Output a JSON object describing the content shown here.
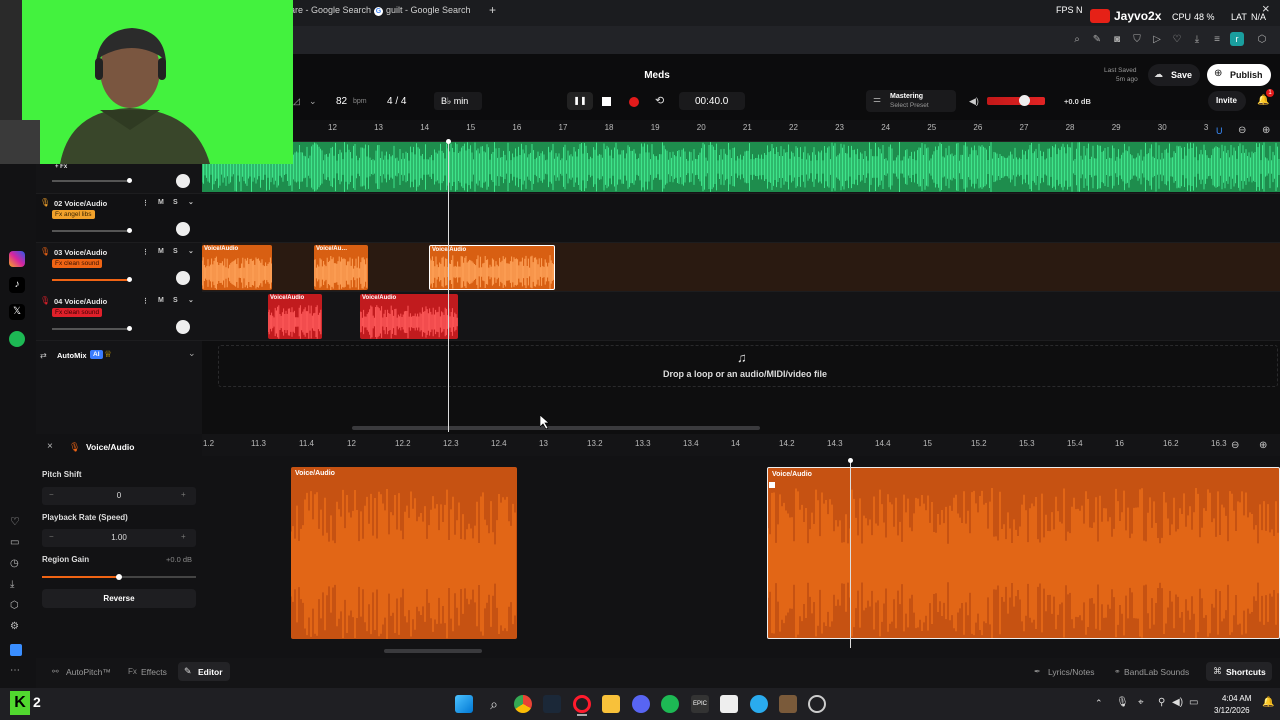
{
  "browser": {
    "tabs": [
      {
        "label": "are - Google Search"
      },
      {
        "label": "guilt - Google Search"
      }
    ],
    "new_tab": "+",
    "overlay": {
      "fps": "FPS",
      "n": "N",
      "channel": "Jayvo2x",
      "cpu": "CPU",
      "cpu_val": "48 %",
      "lat": "LAT",
      "lat_val": "N/A",
      "close": "×"
    },
    "profile_initial": "r"
  },
  "project": {
    "title": "Meds",
    "tempo": "82",
    "tempo_unit": "bpm",
    "time_sig": "4 / 4",
    "key": "B♭ min",
    "time": "00:40.0",
    "mastering_label": "Mastering",
    "mastering_preset": "Select Preset",
    "volume_db": "+0.0 dB",
    "last_saved_label": "Last Saved",
    "last_saved_time": "5m ago",
    "save_label": "Save",
    "publish_label": "Publish",
    "invite_label": "Invite",
    "notif_count": "1"
  },
  "ruler": [
    "12",
    "13",
    "14",
    "15",
    "16",
    "17",
    "18",
    "19",
    "20",
    "21",
    "22",
    "23",
    "24",
    "25",
    "26",
    "27",
    "28",
    "29",
    "30",
    "3"
  ],
  "tracks": [
    {
      "name": "+ Fx",
      "fx": "",
      "fx_color": ""
    },
    {
      "name": "02  Voice/Audio",
      "fx": "Fx  angel libs",
      "fx_color": "#f2a22b"
    },
    {
      "name": "03  Voice/Audio",
      "fx": "Fx  clean sound",
      "fx_color": "#f06414"
    },
    {
      "name": "04  Voice/Audio",
      "fx": "Fx  clean sound",
      "fx_color": "#e0202a"
    }
  ],
  "track_buttons": {
    "mute": "M",
    "solo": "S"
  },
  "clips": {
    "track3": [
      "Voice/Audio",
      "Voice/Au…",
      "Voice/Audio"
    ],
    "track4": [
      "Voice/Audio",
      "Voice/Audio"
    ]
  },
  "automix": {
    "label": "AutoMix",
    "badge": "AI"
  },
  "drop_text": "Drop a loop or an audio/MIDI/video file",
  "editor": {
    "title": "Voice/Audio",
    "ruler": [
      "1.2",
      "11.3",
      "11.4",
      "12",
      "12.2",
      "12.3",
      "12.4",
      "13",
      "13.2",
      "13.3",
      "13.4",
      "14",
      "14.2",
      "14.3",
      "14.4",
      "15",
      "15.2",
      "15.3",
      "15.4",
      "16",
      "16.2",
      "16.3"
    ],
    "pitch_label": "Pitch Shift",
    "pitch_value": "0",
    "rate_label": "Playback Rate (Speed)",
    "rate_value": "1.00",
    "gain_label": "Region Gain",
    "gain_value": "+0.0 dB",
    "reverse_label": "Reverse",
    "minus": "−",
    "plus": "+",
    "clip1_label": "Voice/Audio",
    "clip2_label": "Voice/Audio"
  },
  "bottom_tabs": {
    "autopitch": "AutoPitch™",
    "effects": "Effects",
    "editor": "Editor",
    "lyrics": "Lyrics/Notes",
    "sounds": "BandLab Sounds",
    "shortcuts": "Shortcuts"
  },
  "taskbar": {
    "app_badge": "2",
    "time": "4:04 AM",
    "date": "3/12/2026"
  },
  "colors": {
    "green_track": "#23c068",
    "orange_clip": "#ee6a13",
    "red_clip": "#d81e22",
    "accent": "#ff6a00"
  }
}
